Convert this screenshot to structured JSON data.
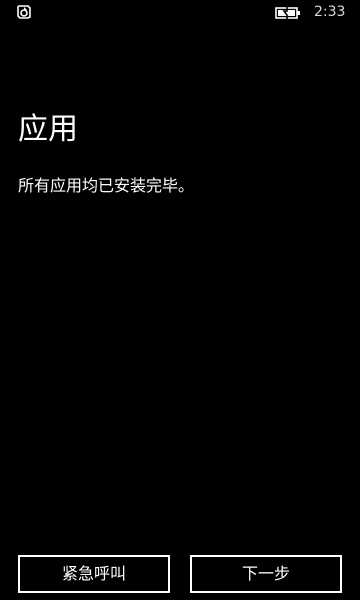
{
  "status_bar": {
    "time": "2:33",
    "left_icon": "wifi-sync-icon",
    "battery_icon": "battery-charging-icon"
  },
  "page": {
    "title": "应用",
    "message": "所有应用均已安装完毕。"
  },
  "buttons": {
    "emergency_call": "紧急呼叫",
    "next": "下一步"
  },
  "colors": {
    "background": "#000000",
    "foreground": "#ffffff",
    "clock": "#d8d8d8"
  }
}
